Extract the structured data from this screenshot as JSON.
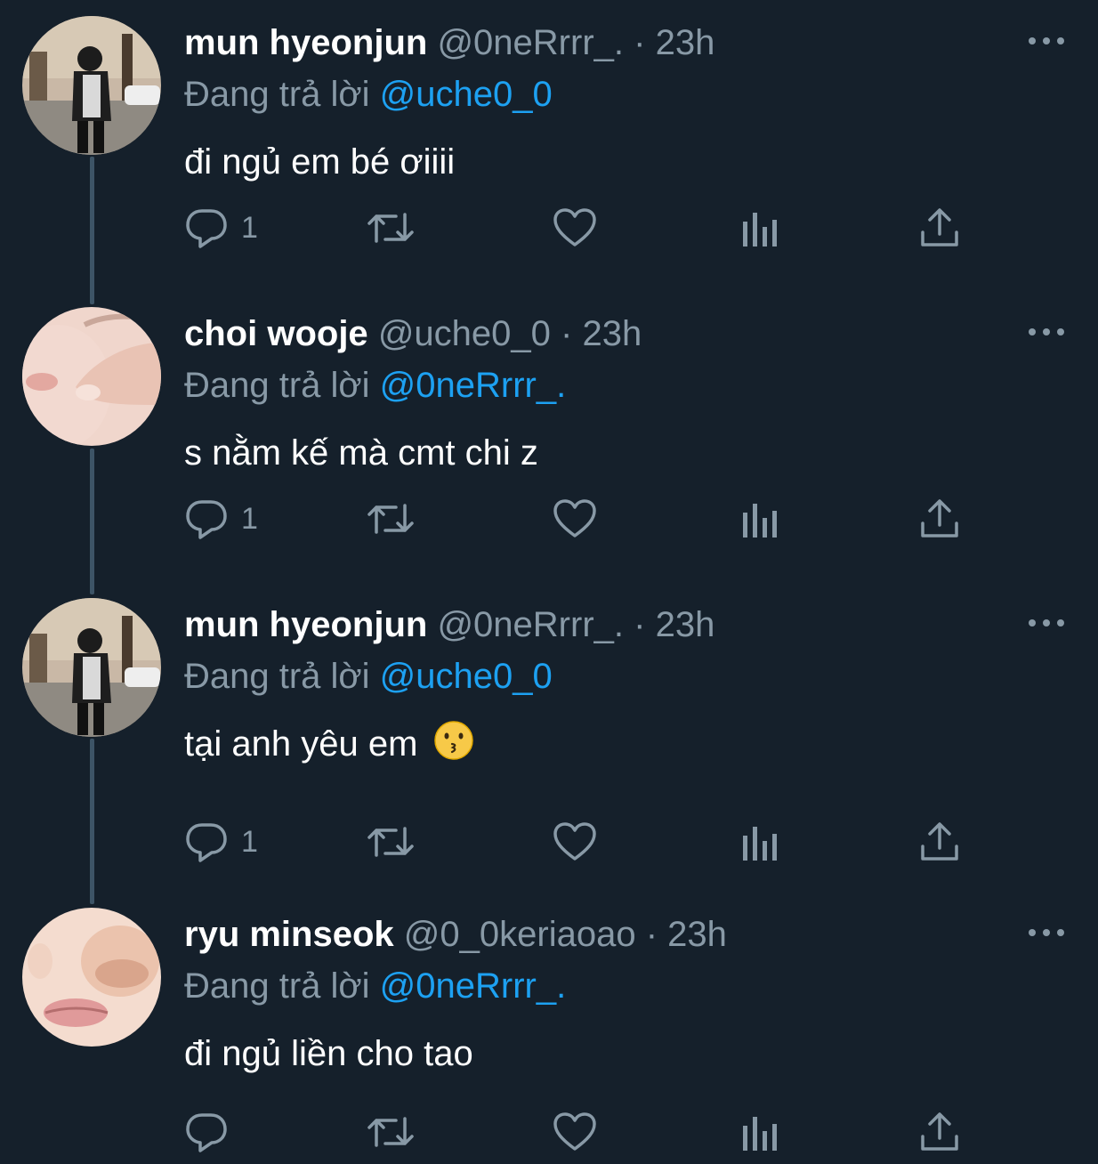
{
  "tweets": [
    {
      "name": "mun hyeonjun",
      "handle": "@0neRrrr_.",
      "separator": "·",
      "time": "23h",
      "replying_label": "Đang trả lời",
      "replying_to": "@uche0_0",
      "text": "đi ngủ em bé ơiiii",
      "emoji": "",
      "reply_count": "1"
    },
    {
      "name": "choi wooje",
      "handle": "@uche0_0",
      "separator": "·",
      "time": "23h",
      "replying_label": "Đang trả lời",
      "replying_to": "@0neRrrr_.",
      "text": "s nằm kế mà cmt chi z",
      "emoji": "",
      "reply_count": "1"
    },
    {
      "name": "mun hyeonjun",
      "handle": "@0neRrrr_.",
      "separator": "·",
      "time": "23h",
      "replying_label": "Đang trả lời",
      "replying_to": "@uche0_0",
      "text": "tại anh yêu em",
      "emoji": "kissing-face-emoji",
      "reply_count": "1"
    },
    {
      "name": "ryu minseok",
      "handle": "@0_0keriaoao",
      "separator": "·",
      "time": "23h",
      "replying_label": "Đang trả lời",
      "replying_to": "@0neRrrr_.",
      "text": "đi ngủ liền cho tao",
      "emoji": "",
      "reply_count": ""
    }
  ],
  "icons": {
    "reply": "reply-icon",
    "retweet": "retweet-icon",
    "like": "heart-icon",
    "analytics": "analytics-icon",
    "share": "share-icon",
    "more": "more-icon"
  },
  "colors": {
    "background": "#15202b",
    "secondary_text": "#8899a6",
    "mention": "#1da1f2",
    "thread_line": "#3d5466"
  }
}
